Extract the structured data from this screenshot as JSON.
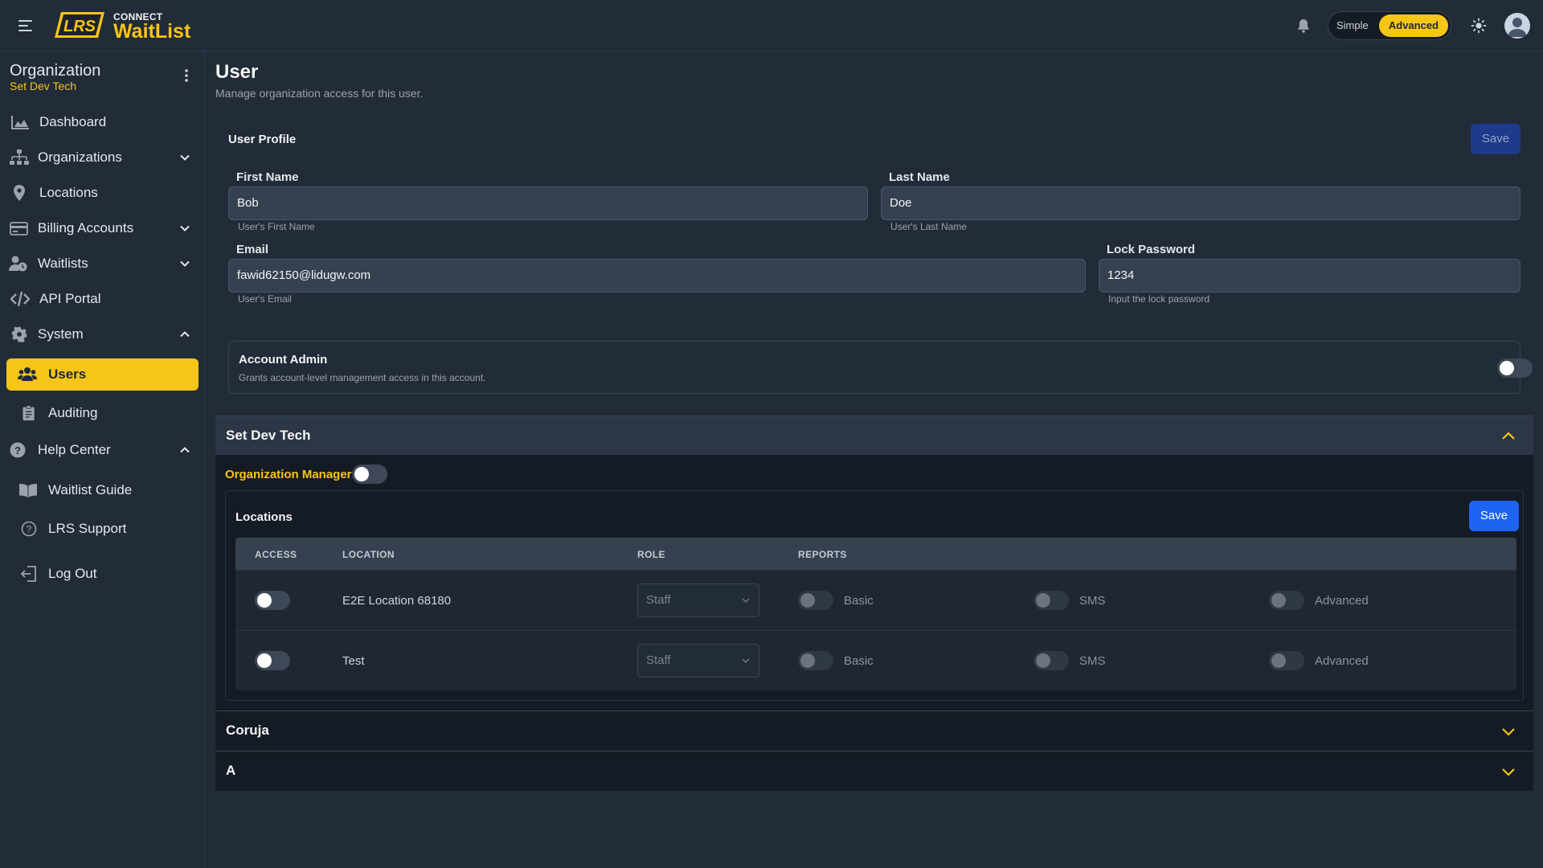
{
  "header": {
    "brand_small": "CONNECT",
    "brand_name": "WaitList",
    "logo_text": "LRS",
    "mode_simple": "Simple",
    "mode_advanced": "Advanced",
    "mode_selected": "Advanced",
    "accent_color": "#f5c518"
  },
  "sidebar": {
    "org_title": "Organization",
    "org_name": "Set Dev Tech",
    "items": [
      {
        "label": "Dashboard",
        "icon": "chart-area-icon",
        "expandable": false
      },
      {
        "label": "Organizations",
        "icon": "sitemap-icon",
        "expandable": true,
        "expanded": false
      },
      {
        "label": "Locations",
        "icon": "map-pin-icon",
        "expandable": false
      },
      {
        "label": "Billing Accounts",
        "icon": "credit-card-icon",
        "expandable": true,
        "expanded": false
      },
      {
        "label": "Waitlists",
        "icon": "user-clock-icon",
        "expandable": true,
        "expanded": false
      },
      {
        "label": "API Portal",
        "icon": "code-icon",
        "expandable": false
      },
      {
        "label": "System",
        "icon": "gear-icon",
        "expandable": true,
        "expanded": true
      },
      {
        "label": "Users",
        "icon": "users-icon",
        "active": true
      },
      {
        "label": "Auditing",
        "icon": "clipboard-icon"
      },
      {
        "label": "Help Center",
        "icon": "question-circle-icon",
        "expandable": true,
        "expanded": true
      },
      {
        "label": "Waitlist Guide",
        "icon": "book-open-icon"
      },
      {
        "label": "LRS Support",
        "icon": "question-outline-icon"
      },
      {
        "label": "Log Out",
        "icon": "logout-icon"
      }
    ]
  },
  "page": {
    "title": "User",
    "subtitle": "Manage organization access for this user."
  },
  "profile": {
    "section_label": "User Profile",
    "save_label": "Save",
    "first_name": {
      "label": "First Name",
      "value": "Bob",
      "help": "User's First Name"
    },
    "last_name": {
      "label": "Last Name",
      "value": "Doe",
      "help": "User's Last Name"
    },
    "email": {
      "label": "Email",
      "value": "fawid62150@lidugw.com",
      "help": "User's Email"
    },
    "lock_password": {
      "label": "Lock Password",
      "value": "1234",
      "help": "Input the lock password"
    }
  },
  "account_admin": {
    "title": "Account Admin",
    "description": "Grants account-level management access in this account.",
    "enabled": false
  },
  "organizations": [
    {
      "name": "Set Dev Tech",
      "expanded": true,
      "org_manager_label": "Organization Manager",
      "org_manager_enabled": false,
      "locations_title": "Locations",
      "save_label": "Save",
      "columns": [
        "ACCESS",
        "LOCATION",
        "ROLE",
        "REPORTS"
      ],
      "rows": [
        {
          "access": false,
          "location": "E2E Location 68180",
          "role": "Staff",
          "reports": {
            "basic": false,
            "sms": false,
            "advanced": false
          }
        },
        {
          "access": false,
          "location": "Test",
          "role": "Staff",
          "reports": {
            "basic": false,
            "sms": false,
            "advanced": false
          }
        }
      ],
      "report_labels": {
        "basic": "Basic",
        "sms": "SMS",
        "advanced": "Advanced"
      }
    },
    {
      "name": "Coruja",
      "expanded": false
    },
    {
      "name": "A",
      "expanded": false
    }
  ]
}
